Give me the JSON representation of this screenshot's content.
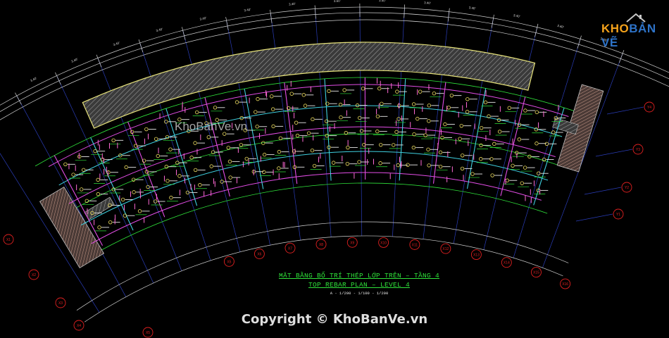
{
  "brand": {
    "logo_part1": "KHO",
    "logo_part2": "BẢN VẼ",
    "watermark": "KhoBanVe.vn",
    "copyright": "Copyright © KhoBanVe.vn"
  },
  "drawing": {
    "title_vn": "MẶT BẰNG BỐ TRÍ THÉP LỚP TRÊN – TẦNG 4",
    "title_en": "TOP REBAR PLAN – LEVEL 4",
    "scale_note": "A - 1/200 - 1/100 - 1/200",
    "bottom_axis_labels": [
      "X5",
      "X6",
      "X7",
      "X8",
      "X9",
      "X10",
      "X11",
      "X12",
      "X13",
      "X14",
      "X15",
      "X16"
    ],
    "left_axis_labels": [
      "X1",
      "X2",
      "X3",
      "X4",
      "X5"
    ],
    "right_axis_labels": [
      "Y4",
      "Y3",
      "Y2",
      "Y1"
    ],
    "dimension_labels": [
      "3.60'",
      "3.40'",
      "3.40'",
      "3.40'",
      "3.40'",
      "3.40'",
      "3.40'",
      "3.40'"
    ]
  },
  "colors": {
    "background": "#000000",
    "hatch": "#8a8a8a",
    "slab_outline": "#e6e27a",
    "beam_magenta": "#e34de6",
    "beam_cyan": "#3fd0e0",
    "grid_blue": "#2a3db8",
    "bubble_red": "#e02020",
    "rebar_green": "#2fe23a",
    "title_green": "#2fe23a"
  }
}
